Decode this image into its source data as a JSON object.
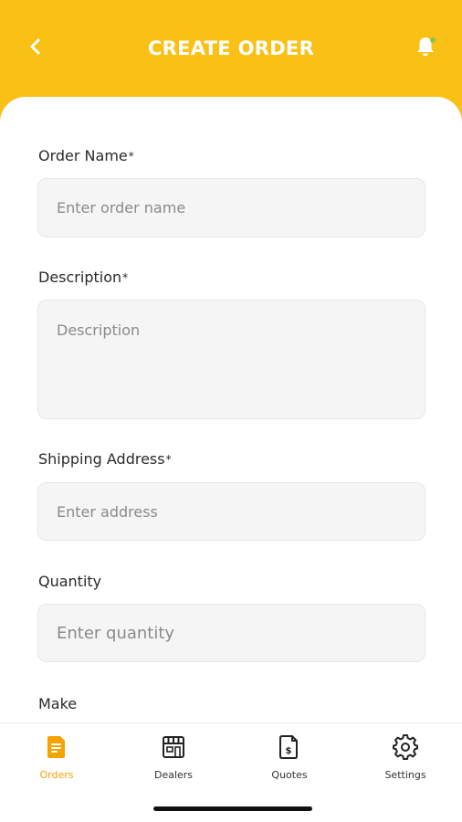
{
  "header": {
    "title": "CREATE ORDER",
    "back_icon": "chevron-left-icon",
    "bell_icon": "bell-icon",
    "background_color": "#F9C016"
  },
  "form": {
    "order_name": {
      "label": "Order Name",
      "required": "*",
      "placeholder": "Enter order name",
      "value": ""
    },
    "description": {
      "label": "Description",
      "required": "*",
      "placeholder": "Description",
      "value": ""
    },
    "shipping_address": {
      "label": "Shipping Address",
      "required": "*",
      "placeholder": "Enter address",
      "value": ""
    },
    "quantity": {
      "label": "Quantity",
      "placeholder": "Enter quantity",
      "value": ""
    },
    "make": {
      "label": "Make"
    }
  },
  "bottom_nav": {
    "items": [
      {
        "label": "Orders",
        "icon": "orders-document-icon",
        "active": true
      },
      {
        "label": "Dealers",
        "icon": "storefront-icon",
        "active": false
      },
      {
        "label": "Quotes",
        "icon": "dollar-document-icon",
        "active": false
      },
      {
        "label": "Settings",
        "icon": "gear-icon",
        "active": false
      }
    ],
    "active_color": "#F5A300"
  }
}
